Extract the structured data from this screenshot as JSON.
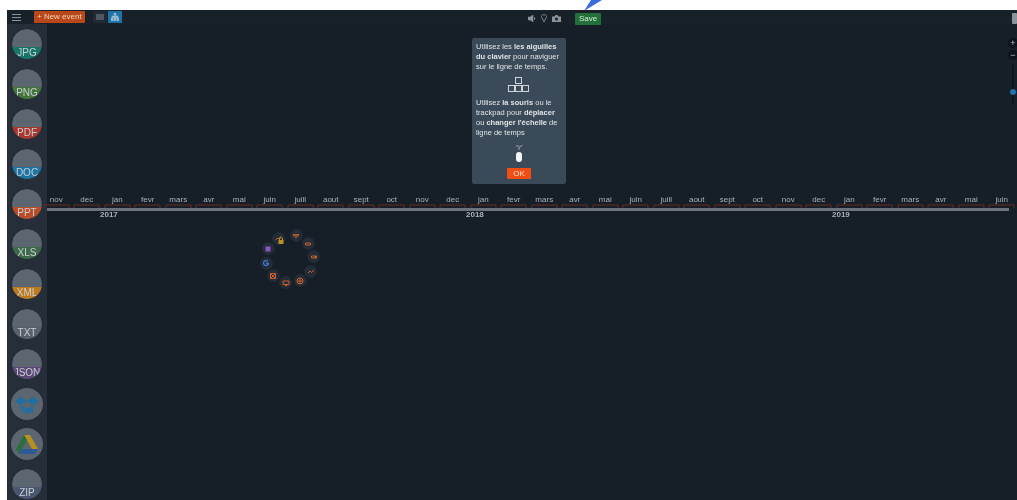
{
  "toolbar": {
    "new_event": "+ New event",
    "views": [
      {
        "kind": "list",
        "selected": false
      },
      {
        "kind": "tree",
        "selected": true
      }
    ],
    "save": "Save"
  },
  "sidebar": {
    "items": [
      {
        "kind": "file",
        "label": "JPG",
        "color": "#17766a"
      },
      {
        "kind": "file",
        "label": "PNG",
        "color": "#44753a"
      },
      {
        "kind": "file",
        "label": "PDF",
        "color": "#a8372e"
      },
      {
        "kind": "file",
        "label": "DOC",
        "color": "#1c74a3"
      },
      {
        "kind": "file",
        "label": "PPT",
        "color": "#b84d27"
      },
      {
        "kind": "file",
        "label": "XLS",
        "color": "#3d6a48"
      },
      {
        "kind": "file",
        "label": "XML",
        "color": "#bd7a1e"
      },
      {
        "kind": "file",
        "label": "TXT",
        "color": "#59626b"
      },
      {
        "kind": "file",
        "label": "JSON",
        "color": "#5a4775"
      },
      {
        "kind": "dropbox"
      },
      {
        "kind": "drive"
      },
      {
        "kind": "file",
        "label": "ZIP",
        "color": "#4a5670"
      }
    ]
  },
  "hint": {
    "text_1": "Utilisez les **les aiguilles du clavier** pour naviguer sur le ligne de temps.",
    "text_2": "Utilisez **la souris** ou le trackpad pour **déplacer** ou **changer l'échelle** de ligne de temps",
    "ok": "OK"
  },
  "zoom": {
    "plus": "+",
    "minus": "−",
    "level": 0.3
  },
  "timeline": {
    "months": [
      {
        "label": "nov"
      },
      {
        "label": "dec"
      },
      {
        "label": "jan",
        "year": "2017"
      },
      {
        "label": "fevr"
      },
      {
        "label": "mars"
      },
      {
        "label": "avr"
      },
      {
        "label": "mai"
      },
      {
        "label": "juin"
      },
      {
        "label": "juill"
      },
      {
        "label": "aout"
      },
      {
        "label": "sept"
      },
      {
        "label": "oct"
      },
      {
        "label": "nov"
      },
      {
        "label": "dec"
      },
      {
        "label": "jan",
        "year": "2018"
      },
      {
        "label": "fevr"
      },
      {
        "label": "mars"
      },
      {
        "label": "avr"
      },
      {
        "label": "mai"
      },
      {
        "label": "juin"
      },
      {
        "label": "juill"
      },
      {
        "label": "aout"
      },
      {
        "label": "sept"
      },
      {
        "label": "oct"
      },
      {
        "label": "nov"
      },
      {
        "label": "dec"
      },
      {
        "label": "jan",
        "year": "2019"
      },
      {
        "label": "fevr"
      },
      {
        "label": "mars"
      },
      {
        "label": "avr"
      },
      {
        "label": "mai"
      },
      {
        "label": "juin"
      }
    ]
  }
}
